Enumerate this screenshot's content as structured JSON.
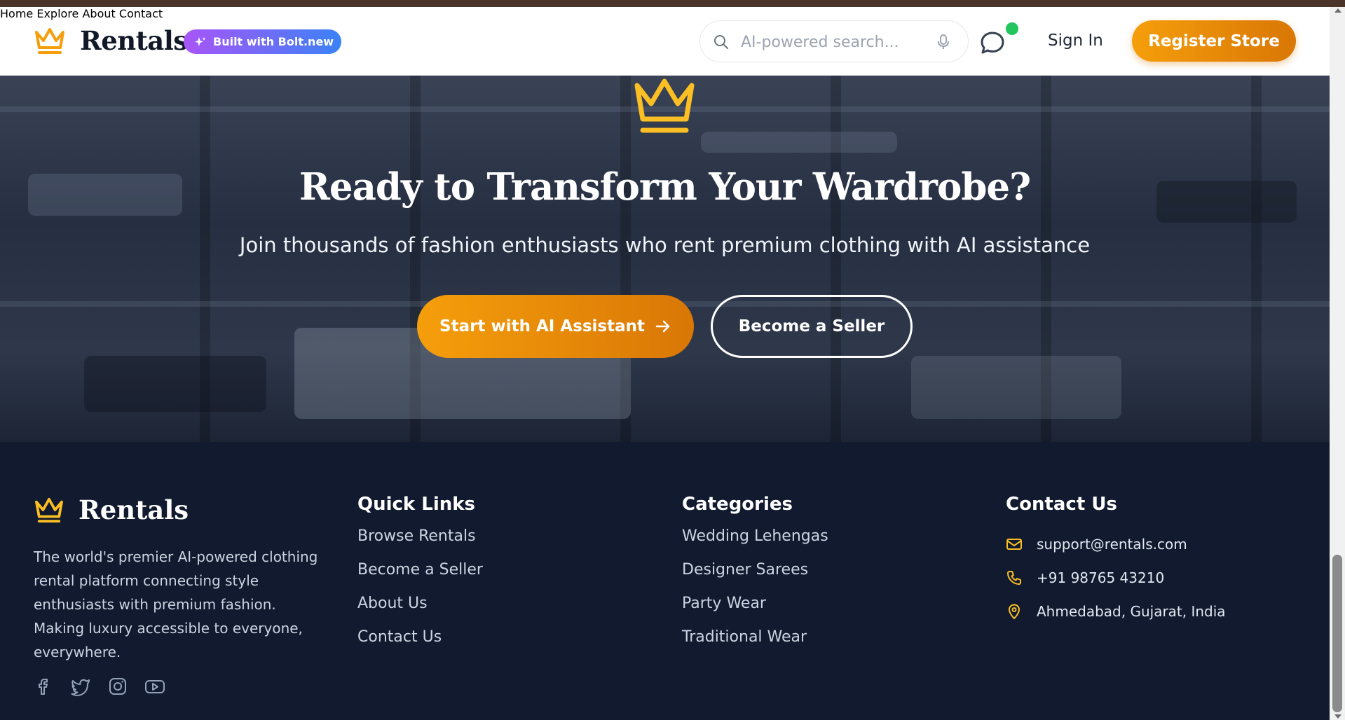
{
  "header": {
    "brand": "Rentals",
    "bolt_badge": "Built with Bolt.new",
    "nav": [
      "Home",
      "Explore",
      "About",
      "Contact"
    ],
    "search_placeholder": "AI-powered search...",
    "sign_in": "Sign In",
    "register": "Register Store",
    "accent": "#f59e0b",
    "online_dot_color": "#22c55e"
  },
  "hero": {
    "title": "Ready to Transform Your Wardrobe?",
    "subtitle": "Join thousands of fashion enthusiasts who rent premium clothing with AI assistance",
    "primary_button": "Start with AI Assistant",
    "secondary_button": "Become a Seller",
    "crown_color": "#fbbf24"
  },
  "footer": {
    "brand": "Rentals",
    "description": "The world's premier AI-powered clothing rental platform connecting style enthusiasts with premium fashion. Making luxury accessible to everyone, everywhere.",
    "socials": [
      "facebook-icon",
      "twitter-icon",
      "instagram-icon",
      "youtube-icon"
    ],
    "quick_links": {
      "heading": "Quick Links",
      "items": [
        "Browse Rentals",
        "Become a Seller",
        "About Us",
        "Contact Us"
      ]
    },
    "categories": {
      "heading": "Categories",
      "items": [
        "Wedding Lehengas",
        "Designer Sarees",
        "Party Wear",
        "Traditional Wear"
      ]
    },
    "contact": {
      "heading": "Contact Us",
      "email": "support@rentals.com",
      "phone": "+91 98765 43210",
      "address": "Ahmedabad, Gujarat, India"
    }
  }
}
